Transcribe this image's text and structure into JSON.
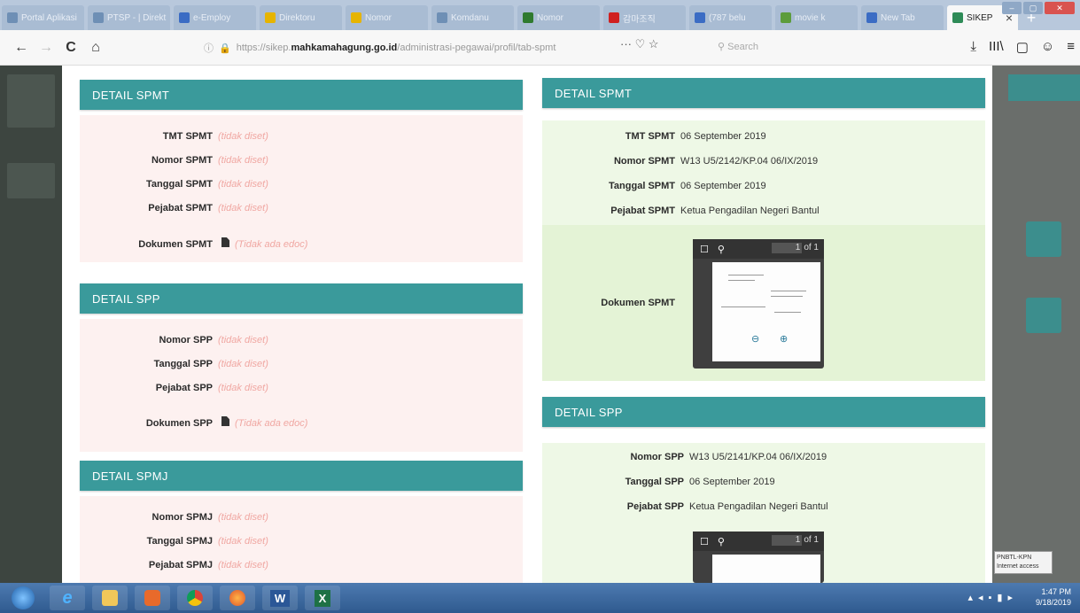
{
  "browser": {
    "tabs": [
      {
        "label": "Portal Aplikasi",
        "color": "#6e8fb5"
      },
      {
        "label": "PTSP - | Direkt",
        "color": "#6e8fb5"
      },
      {
        "label": "e-Employ",
        "color": "#3b6cc4"
      },
      {
        "label": "Direktoru",
        "color": "#e6b400"
      },
      {
        "label": "Nomor",
        "color": "#e6b400"
      },
      {
        "label": "Komdanu",
        "color": "#6e8fb5"
      },
      {
        "label": "Nomor",
        "color": "#2f7a2f"
      },
      {
        "label": "감마조직",
        "color": "#d02020"
      },
      {
        "label": "(787 belu",
        "color": "#3b6cc4"
      },
      {
        "label": "movie k",
        "color": "#5c9c3c"
      },
      {
        "label": "New Tab",
        "color": "#3b6cc4"
      }
    ],
    "active_tab": {
      "label": "SIKEP",
      "close": "×"
    },
    "new_tab": "+",
    "url_prefix": "https://sikep.",
    "url_domain": "mahkamahagung.go.id",
    "url_path": "/administrasi-pegawai/profil/tab-spmt",
    "page_actions": "··· ♡ ☆",
    "search_placeholder": "Search",
    "nav": {
      "back": "←",
      "forward": "→",
      "reload": "C",
      "home": "⌂"
    },
    "tools": [
      "⤓",
      "III\\",
      "▢",
      "☺",
      "≡"
    ]
  },
  "left_column": {
    "spmt": {
      "title": "DETAIL SPMT",
      "rows": [
        {
          "label": "TMT SPMT",
          "value": "(tidak diset)"
        },
        {
          "label": "Nomor SPMT",
          "value": "(tidak diset)"
        },
        {
          "label": "Tanggal SPMT",
          "value": "(tidak diset)"
        },
        {
          "label": "Pejabat SPMT",
          "value": "(tidak diset)"
        }
      ],
      "doc_label": "Dokumen SPMT",
      "doc_value": "(Tidak ada edoc)"
    },
    "spp": {
      "title": "DETAIL SPP",
      "rows": [
        {
          "label": "Nomor SPP",
          "value": "(tidak diset)"
        },
        {
          "label": "Tanggal SPP",
          "value": "(tidak diset)"
        },
        {
          "label": "Pejabat SPP",
          "value": "(tidak diset)"
        }
      ],
      "doc_label": "Dokumen SPP",
      "doc_value": "(Tidak ada edoc)"
    },
    "spmj": {
      "title": "DETAIL SPMJ",
      "rows": [
        {
          "label": "Nomor SPMJ",
          "value": "(tidak diset)"
        },
        {
          "label": "Tanggal SPMJ",
          "value": "(tidak diset)"
        },
        {
          "label": "Pejabat SPMJ",
          "value": "(tidak diset)"
        }
      ]
    }
  },
  "right_column": {
    "spmt": {
      "title": "DETAIL SPMT",
      "rows": [
        {
          "label": "TMT SPMT",
          "value": "06 September 2019"
        },
        {
          "label": "Nomor SPMT",
          "value": "W13 U5/2142/KP.04 06/IX/2019"
        },
        {
          "label": "Tanggal SPMT",
          "value": "06 September 2019"
        },
        {
          "label": "Pejabat SPMT",
          "value": "Ketua Pengadilan Negeri Bantul"
        }
      ],
      "doc_label": "Dokumen SPMT",
      "viewer_page": "1",
      "viewer_of": "of 1"
    },
    "spp": {
      "title": "DETAIL SPP",
      "rows": [
        {
          "label": "Nomor SPP",
          "value": "W13 U5/2141/KP.04 06/IX/2019"
        },
        {
          "label": "Tanggal SPP",
          "value": "06 September 2019"
        },
        {
          "label": "Pejabat SPP",
          "value": "Ketua Pengadilan Negeri Bantul"
        }
      ],
      "viewer_page": "1",
      "viewer_of": "of 1"
    }
  },
  "taskbar": {
    "time": "1:47 PM",
    "date": "9/18/2019",
    "tooltip": "PNBTL-KPN Internet access",
    "apps": [
      "start",
      "ie",
      "explorer",
      "media",
      "chrome",
      "firefox",
      "word",
      "excel"
    ],
    "word_label": "W",
    "excel_label": "X"
  }
}
